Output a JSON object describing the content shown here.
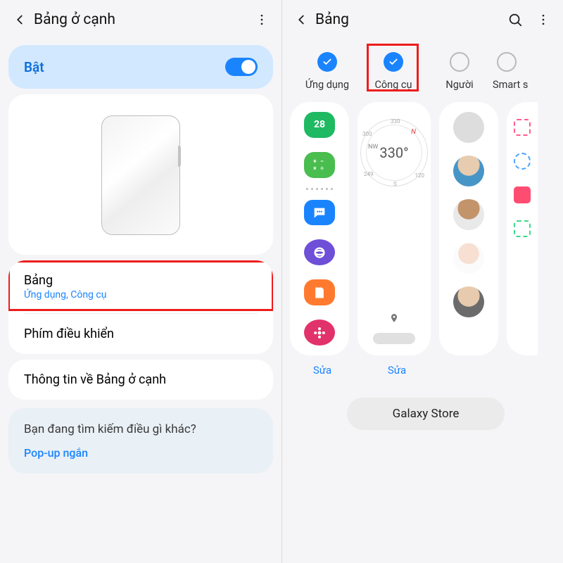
{
  "left": {
    "header": {
      "title": "Bảng ở cạnh"
    },
    "toggle": {
      "label": "Bật"
    },
    "menu": {
      "bang": {
        "title": "Bảng",
        "subtitle": "Ứng dụng, Công cụ"
      },
      "phim": {
        "title": "Phím điều khiển"
      },
      "info": {
        "title": "Thông tin về Bảng ở cạnh"
      }
    },
    "suggest": {
      "question": "Bạn đang tìm kiếm điều gì khác?",
      "link": "Pop-up ngắn"
    }
  },
  "right": {
    "header": {
      "title": "Bảng"
    },
    "categories": {
      "c1": "Ứng dụng",
      "c2": "Công cụ",
      "c3": "Người",
      "c4": "Smart s"
    },
    "compass": {
      "direction": "NW",
      "degrees": "330°",
      "north": "N",
      "t1": "330",
      "t2": "300",
      "t3": "249",
      "t4": "S",
      "t5": "120"
    },
    "edit": "Sửa",
    "galaxy": "Galaxy Store",
    "icons": {
      "calendar": "28",
      "calc": "+−×÷"
    },
    "avatars": {
      "a1": "radial-gradient(circle at 40% 30%, #f4d6c4 40%, #2b3b4b 42%)",
      "a2": "radial-gradient(circle at 50% 30%, #e7ccb0 40%, #4795c7 42%)",
      "a3": "radial-gradient(circle at 50% 30%, #c3936a 40%, #e9e9e9 42%)",
      "a4": "radial-gradient(circle at 50% 35%, #f7e0d2 40%, #fbfbfb 42%)",
      "a5": "radial-gradient(circle at 50% 30%, #e8cbae 40%, #6b6b6b 42%)"
    }
  }
}
